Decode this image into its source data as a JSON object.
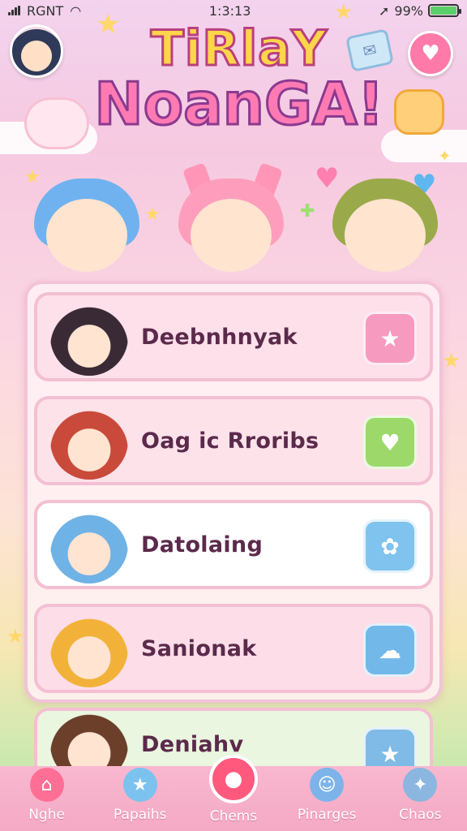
{
  "status": {
    "carrier": "RGNT",
    "time": "1:3:13",
    "battery": "99%",
    "battery_level": 0.99
  },
  "app": {
    "title_line1": "TiRlaY",
    "title_line2": "NoanGA!"
  },
  "list": [
    {
      "name": "Deebnhnyak",
      "card_bg": "#fde0ea",
      "pic_hair": "#3a2a35",
      "act_bg": "#f79ac0",
      "act_icon": "★"
    },
    {
      "name": "Oag ic Rroribs",
      "card_bg": "#fde2ea",
      "pic_hair": "#c94a3a",
      "act_bg": "#9cd96a",
      "act_icon": "♥"
    },
    {
      "name": "Datolaing",
      "card_bg": "#ffffff",
      "pic_hair": "#6fb2e6",
      "act_bg": "#7fc3ee",
      "act_icon": "✿"
    },
    {
      "name": "Sanionak",
      "card_bg": "#fcdde8",
      "pic_hair": "#f2b23a",
      "act_bg": "#72b9ea",
      "act_icon": "☁"
    },
    {
      "name": "Deniahv",
      "card_bg": "#eaf6df",
      "pic_hair": "#6b3f2a",
      "act_bg": "#7fbbe6",
      "act_icon": "★"
    }
  ],
  "nav": [
    {
      "label": "Nghe",
      "icon": "home-icon",
      "glyph": "⌂",
      "color": "#ff6f95"
    },
    {
      "label": "Papaihs",
      "icon": "star-icon",
      "glyph": "★",
      "color": "#7cc2ef"
    },
    {
      "label": "Chems",
      "icon": "chat-bubble-icon",
      "glyph": "●",
      "color": "#ff5a7e"
    },
    {
      "label": "Pinarges",
      "icon": "smile-icon",
      "glyph": "☺",
      "color": "#7cb4ea"
    },
    {
      "label": "Chaos",
      "icon": "gamepad-icon",
      "glyph": "✦",
      "color": "#8bb6e0"
    }
  ]
}
